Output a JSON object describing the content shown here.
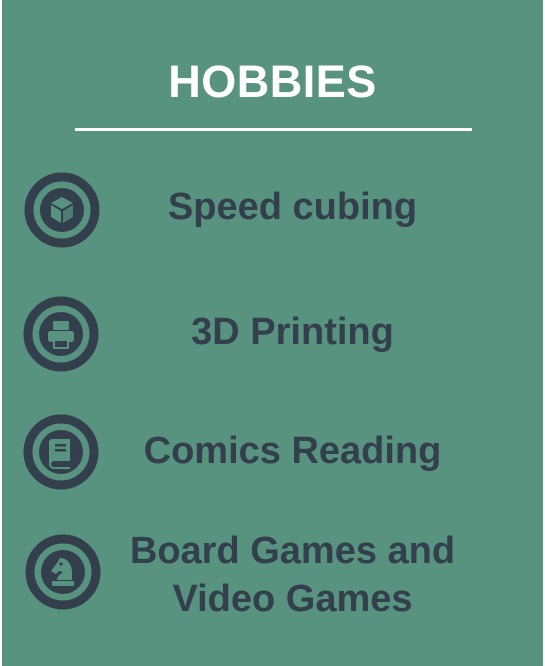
{
  "header": {
    "title": "HOBBIES"
  },
  "hobbies": [
    {
      "icon": "cube-icon",
      "label": "Speed cubing"
    },
    {
      "icon": "printer-icon",
      "label": "3D Printing"
    },
    {
      "icon": "book-icon",
      "label": "Comics Reading"
    },
    {
      "icon": "chess-knight-icon",
      "label_line1": "Board Games and",
      "label_line2": "Video Games"
    }
  ],
  "colors": {
    "background": "#58937f",
    "text_dark": "#333f4c",
    "text_light": "#ffffff"
  }
}
